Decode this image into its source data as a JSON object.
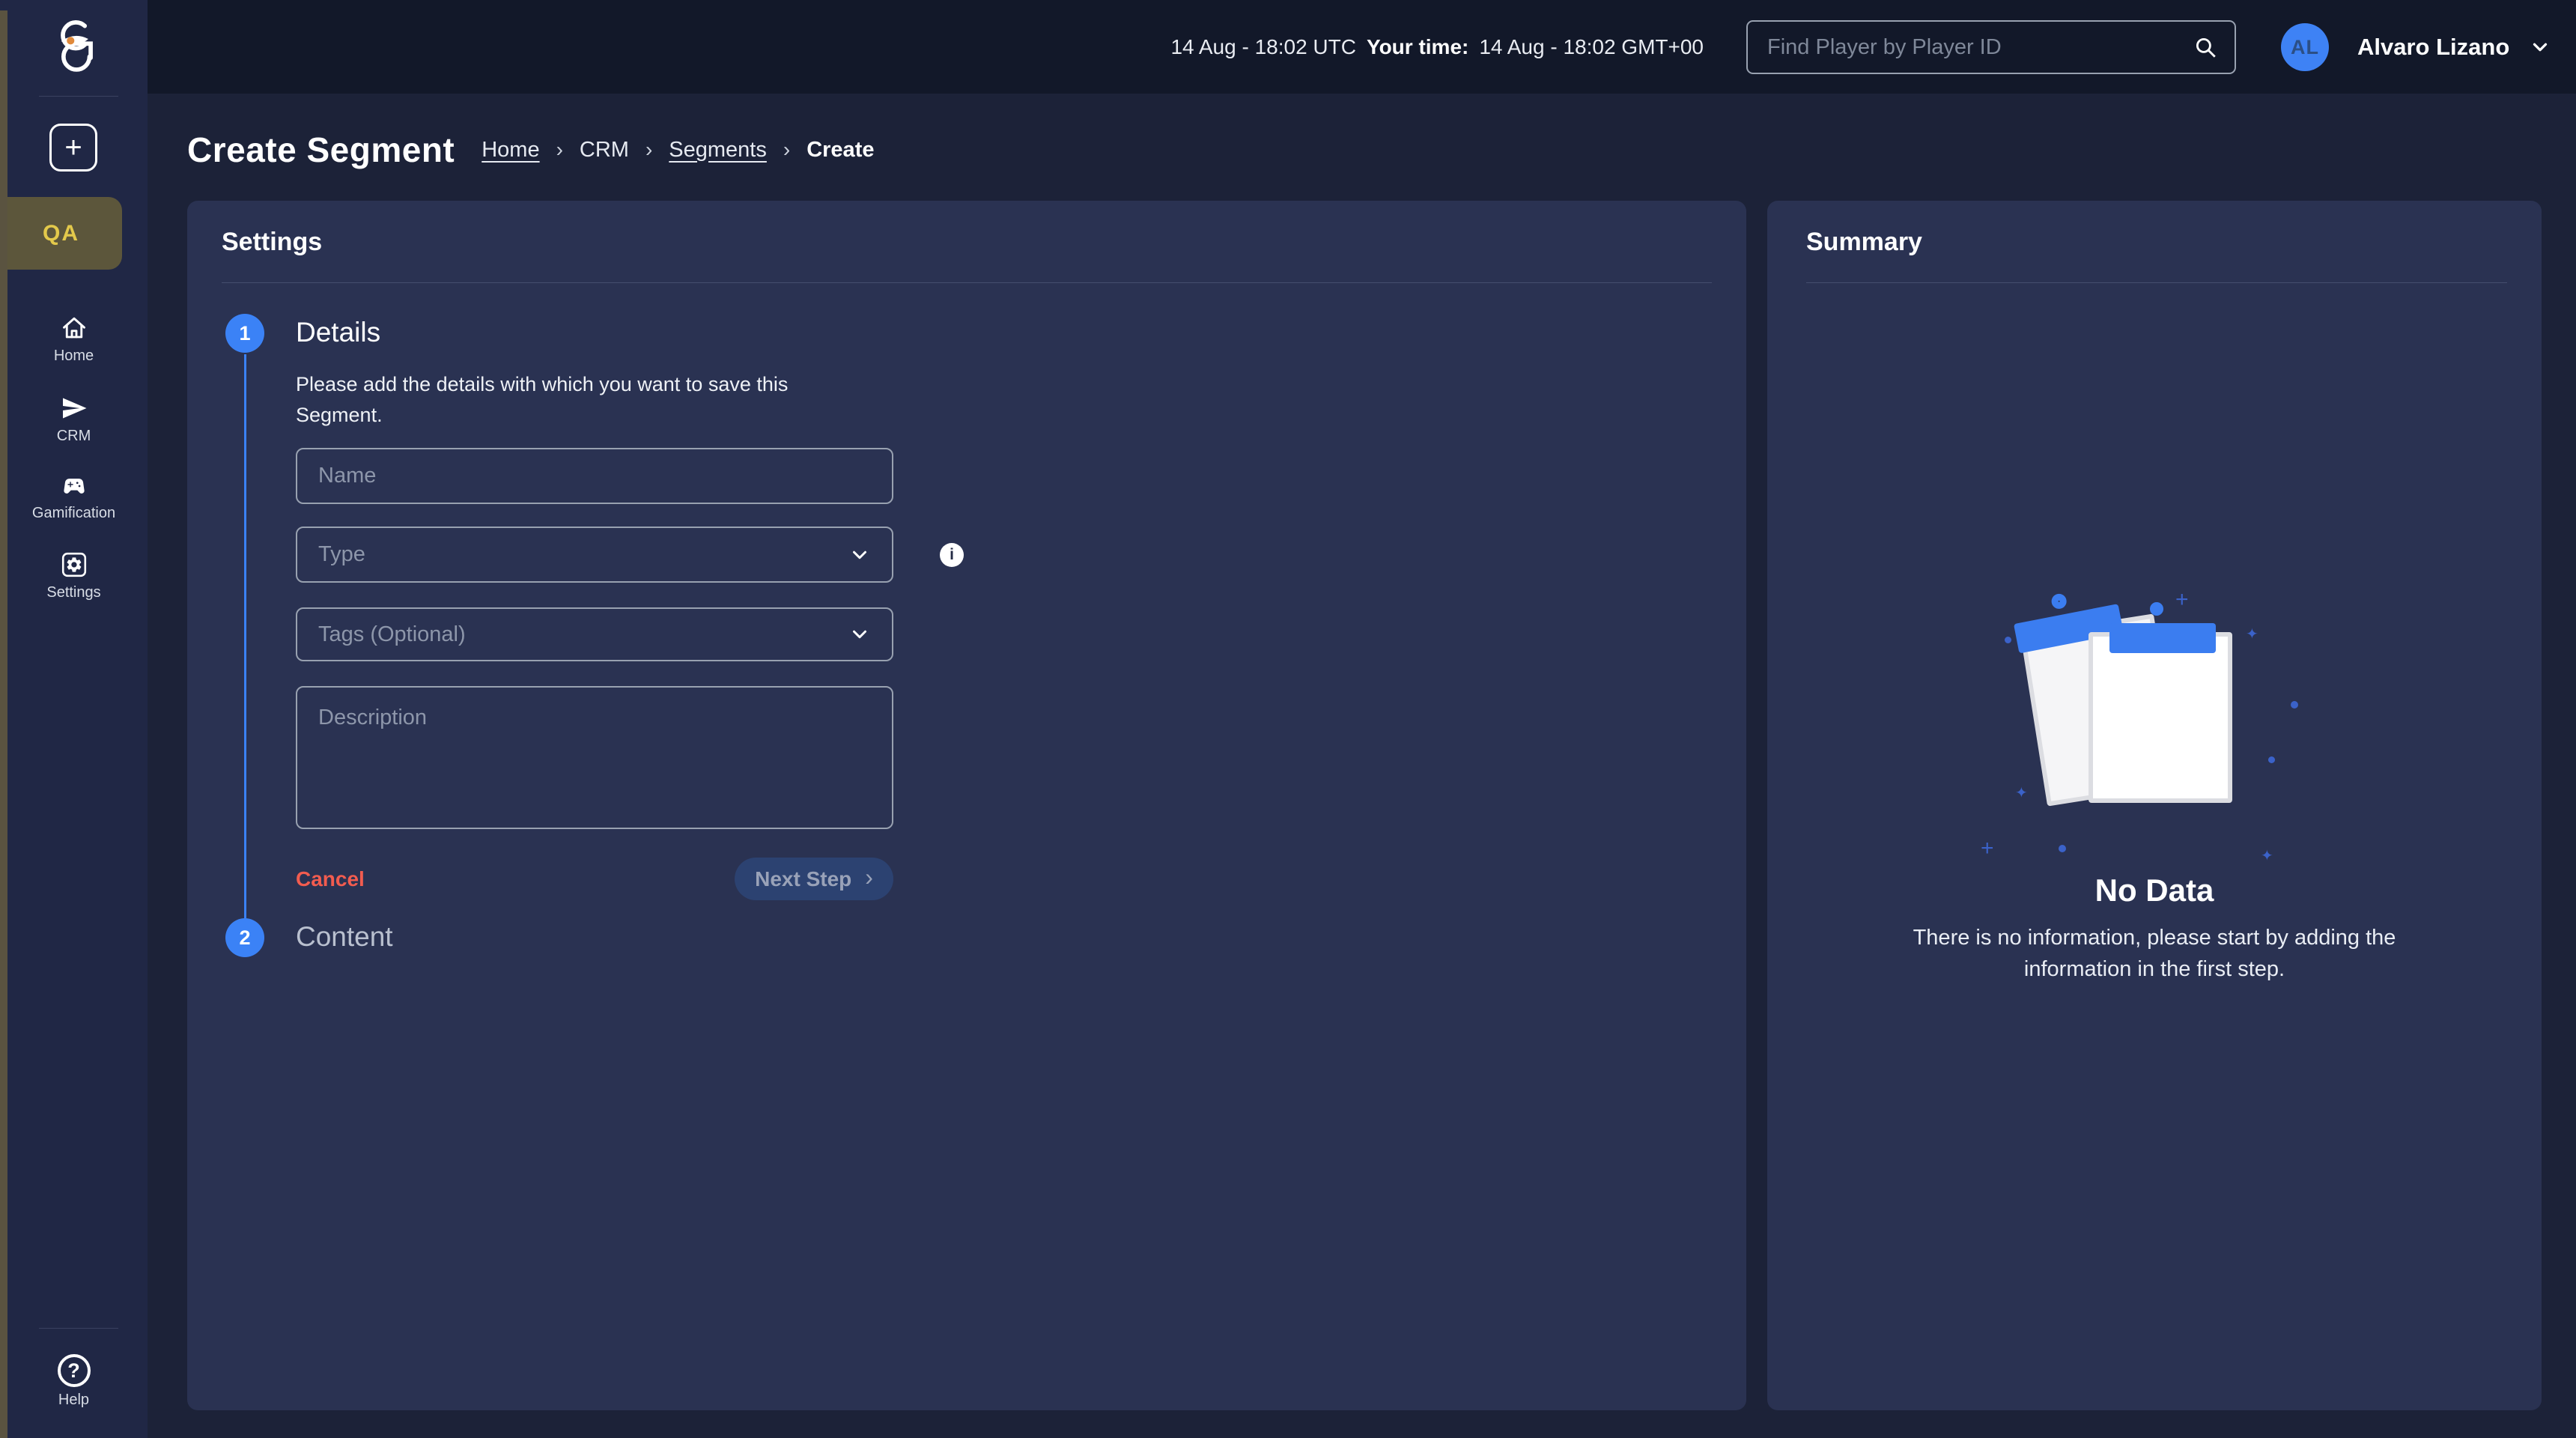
{
  "colors": {
    "accent_blue": "#3b82f6",
    "topbar_bg": "#121829",
    "sidebar_bg": "#202745",
    "main_bg": "#1c2238",
    "panel_bg": "#2a3252",
    "qa_badge_bg": "#5c563b",
    "qa_badge_text": "#e3c94b",
    "cancel_red": "#f25c4f",
    "logo_dot_orange": "#e08a3c",
    "avatar_bg": "#3e82f5"
  },
  "topbar": {
    "utc_time": "14 Aug - 18:02 UTC",
    "your_time_label": "Your time:",
    "local_time": "14 Aug - 18:02 GMT+00",
    "search": {
      "placeholder": "Find Player by Player ID"
    },
    "user": {
      "initials": "AL",
      "name": "Alvaro Lizano"
    }
  },
  "sidebar": {
    "env_badge": "QA",
    "add_button": "+",
    "nav": [
      {
        "label": "Home"
      },
      {
        "label": "CRM"
      },
      {
        "label": "Gamification"
      },
      {
        "label": "Settings"
      }
    ],
    "help": {
      "label": "Help",
      "icon": "?"
    }
  },
  "page": {
    "title": "Create Segment",
    "breadcrumbs": [
      {
        "label": "Home"
      },
      {
        "label": "CRM"
      },
      {
        "label": "Segments"
      },
      {
        "label": "Create"
      }
    ],
    "breadcrumb_separator": "›"
  },
  "settings_panel": {
    "title": "Settings",
    "steps": [
      {
        "number": "1",
        "title": "Details",
        "description": "Please add the details with which you want to save this Segment.",
        "fields": {
          "name_placeholder": "Name",
          "type_placeholder": "Type",
          "tags_placeholder": "Tags (Optional)",
          "description_placeholder": "Description"
        },
        "info_icon": "i",
        "cancel_label": "Cancel",
        "next_label": "Next Step",
        "next_chevron": "›"
      },
      {
        "number": "2",
        "title": "Content"
      }
    ]
  },
  "summary_panel": {
    "title": "Summary",
    "empty_title": "No Data",
    "empty_message": "There is no information, please start by adding the information in the first step."
  }
}
